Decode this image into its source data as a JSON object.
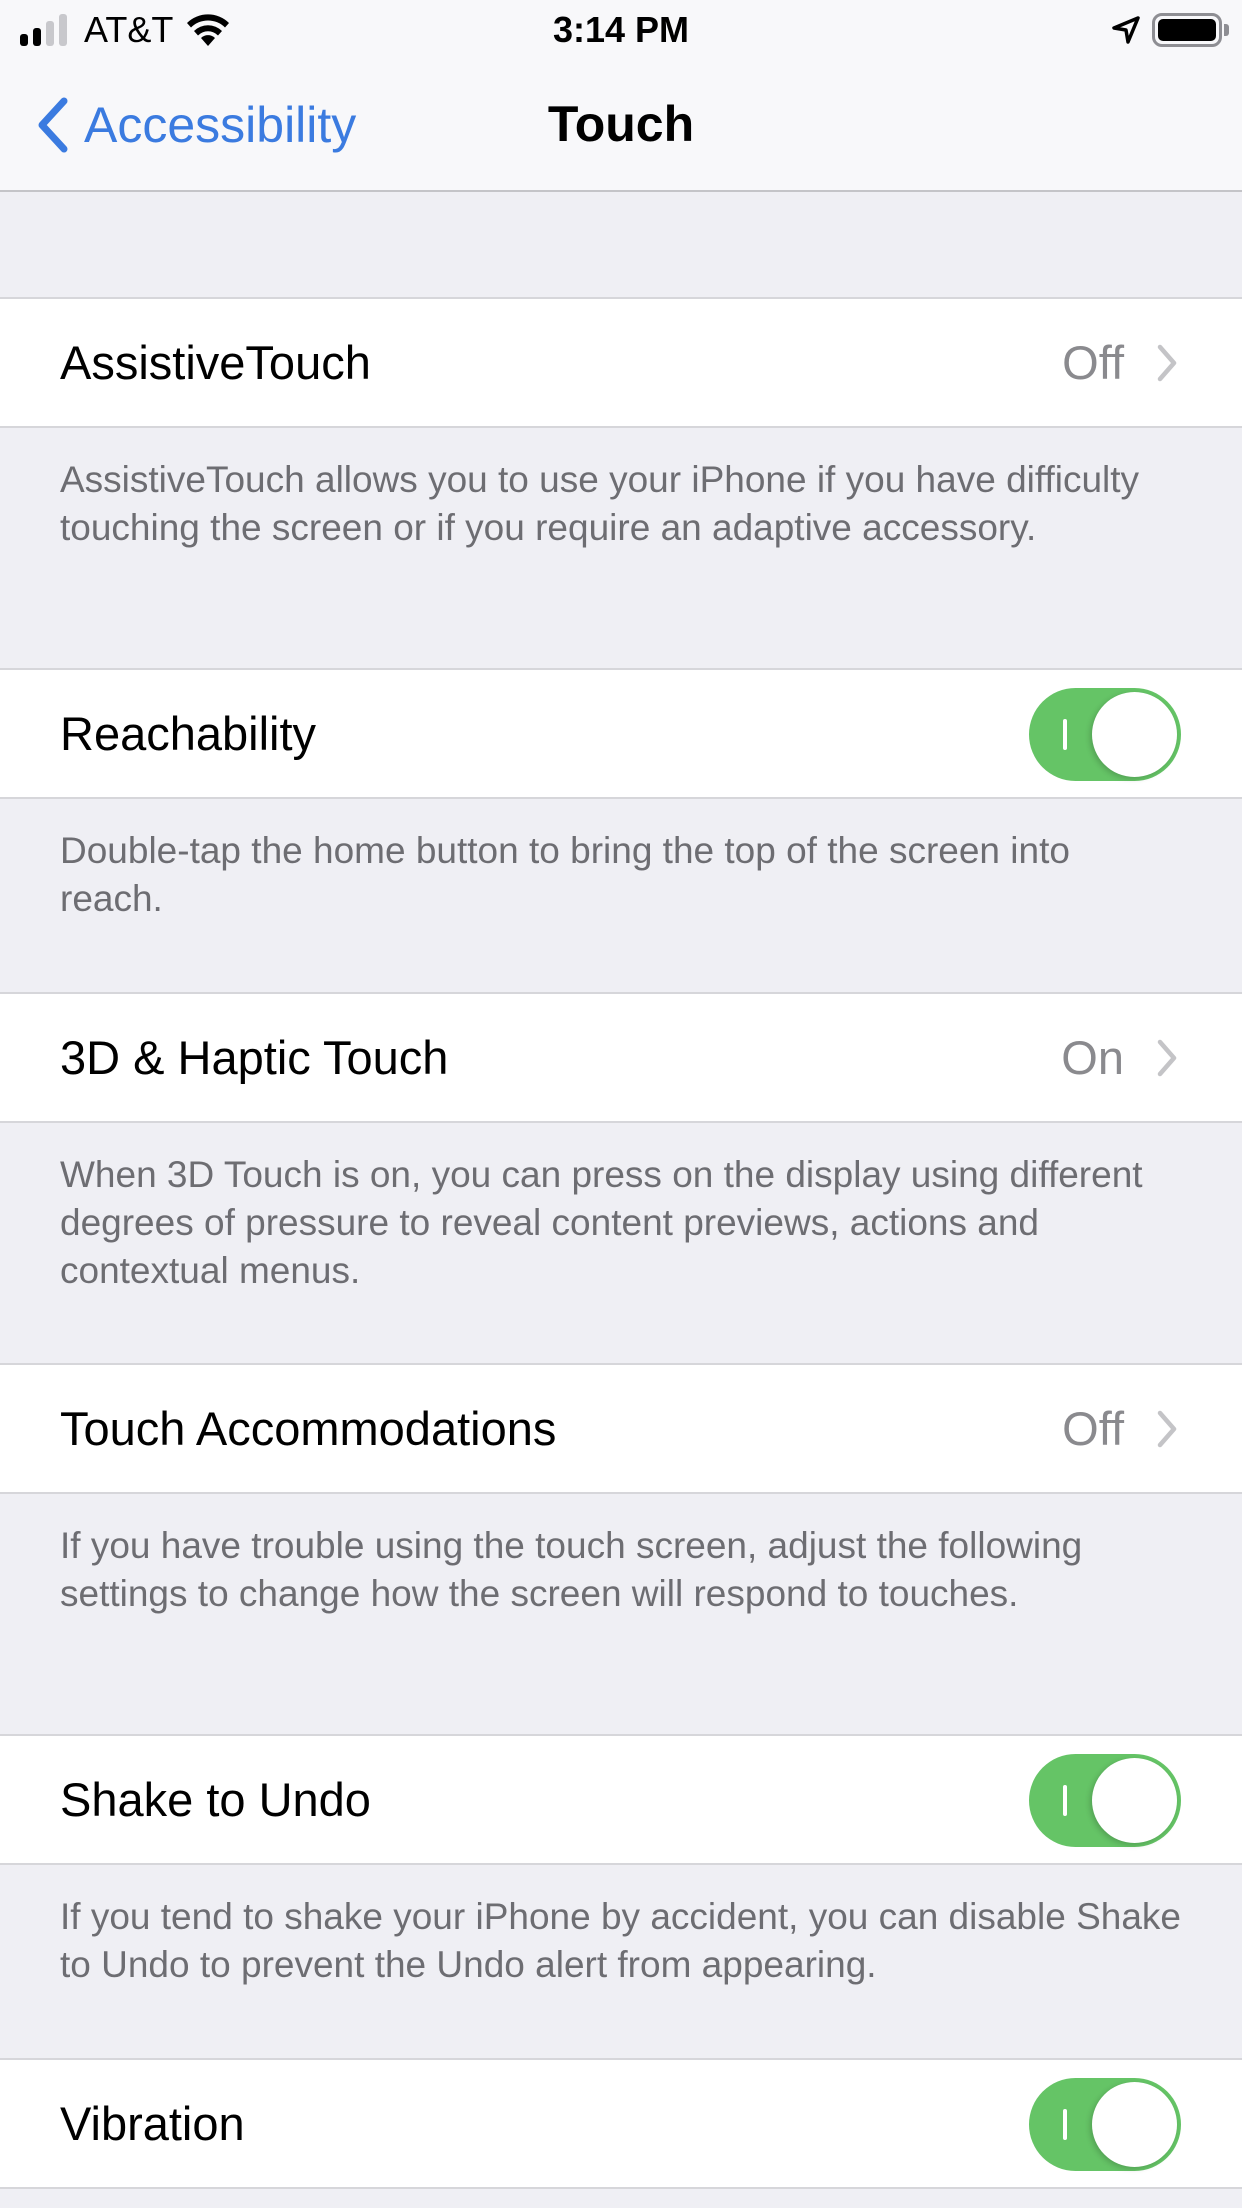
{
  "status_bar": {
    "carrier": "AT&T",
    "time": "3:14 PM",
    "signal_bars_total": 4,
    "signal_bars_filled": 2,
    "wifi_icon": "wifi-icon",
    "location_icon": "location-arrow-icon",
    "battery_level": 1.0
  },
  "nav": {
    "back_label": "Accessibility",
    "back_icon": "chevron-left-icon",
    "title": "Touch"
  },
  "colors": {
    "accent": "#3B7BE0",
    "toggle_on": "#65C466",
    "group_background": "#EFEFF4",
    "secondary_text": "#6D6D72",
    "value_text": "#8A8A8E"
  },
  "settings": [
    {
      "label": "AssistiveTouch",
      "type": "disclosure",
      "value": "Off",
      "description": "AssistiveTouch allows you to use your iPhone if you have difficulty touching the screen or if you require an adaptive accessory."
    },
    {
      "label": "Reachability",
      "type": "toggle",
      "on": true,
      "toggle_on_label": "I",
      "description": "Double-tap the home button to bring the top of the screen into reach."
    },
    {
      "label": "3D & Haptic Touch",
      "type": "disclosure",
      "value": "On",
      "description": "When 3D Touch is on, you can press on the display using different degrees of pressure to reveal content previews, actions and contextual menus."
    },
    {
      "label": "Touch Accommodations",
      "type": "disclosure",
      "value": "Off",
      "description": "If you have trouble using the touch screen, adjust the following settings to change how the screen will respond to touches."
    },
    {
      "label": "Shake to Undo",
      "type": "toggle",
      "on": true,
      "toggle_on_label": "I",
      "description": "If you tend to shake your iPhone by accident, you can disable Shake to Undo to prevent the Undo alert from appearing."
    },
    {
      "label": "Vibration",
      "type": "toggle",
      "on": true,
      "toggle_on_label": "I"
    }
  ]
}
